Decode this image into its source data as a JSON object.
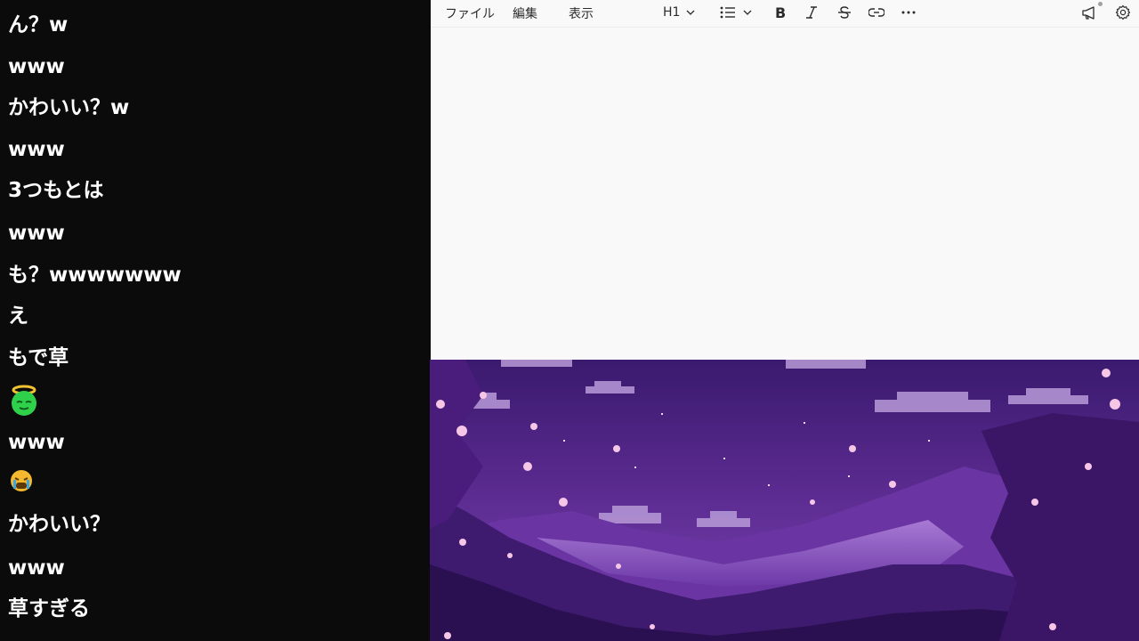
{
  "chat": {
    "messages": [
      {
        "kind": "text",
        "text": "ん？w"
      },
      {
        "kind": "text",
        "text": "www"
      },
      {
        "kind": "text",
        "text": "かわいい？w"
      },
      {
        "kind": "text",
        "text": "www"
      },
      {
        "kind": "text",
        "text": "3つもとは"
      },
      {
        "kind": "text",
        "text": "www"
      },
      {
        "kind": "text",
        "text": "も？wwwwwww"
      },
      {
        "kind": "text",
        "text": "え"
      },
      {
        "kind": "text",
        "text": "もで草"
      },
      {
        "kind": "emoji",
        "icon": "innocent-face-emoji"
      },
      {
        "kind": "text",
        "text": "www"
      },
      {
        "kind": "emoji",
        "icon": "crying-face-emoji"
      },
      {
        "kind": "text",
        "text": "かわいい？"
      },
      {
        "kind": "text",
        "text": "www"
      },
      {
        "kind": "text",
        "text": "草すぎる"
      }
    ]
  },
  "editor": {
    "menu": {
      "file": "ファイル",
      "edit": "編集",
      "view": "表示"
    },
    "toolbar": {
      "heading": "H1",
      "icons": [
        "chevron-down-icon",
        "bulleted-list-icon",
        "bold-icon",
        "italic-icon",
        "strikethrough-icon",
        "link-icon",
        "more-icon",
        "megaphone-icon",
        "gear-icon"
      ]
    }
  },
  "colors": {
    "chat_bg": "#0b0b0b",
    "chat_text": "#ffffff",
    "editor_bg": "#f9f9f9",
    "editor_text": "#2b2b2b",
    "wallpaper_purple": "#5a2a8f"
  },
  "wallpaper": {
    "description_icon": "pixel-art-cherry-blossom-wallpaper"
  }
}
